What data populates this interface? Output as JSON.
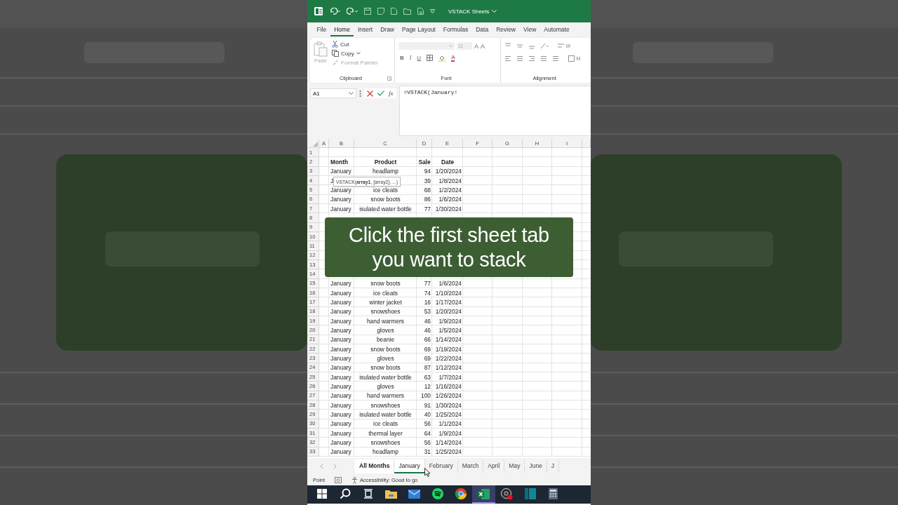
{
  "backdrop": {
    "kind": "picture"
  },
  "title_bar": {
    "title": "VSTACK Sheets"
  },
  "menu_tabs": [
    {
      "label": "File",
      "selected": false
    },
    {
      "label": "Home",
      "selected": true
    },
    {
      "label": "Insert",
      "selected": false
    },
    {
      "label": "Draw",
      "selected": false
    },
    {
      "label": "Page Layout",
      "selected": false
    },
    {
      "label": "Formulas",
      "selected": false
    },
    {
      "label": "Data",
      "selected": false
    },
    {
      "label": "Review",
      "selected": false
    },
    {
      "label": "View",
      "selected": false
    },
    {
      "label": "Automate",
      "selected": false
    }
  ],
  "ribbon": {
    "clipboard": {
      "paste": "Paste",
      "cut": "Cut",
      "copy": "Copy",
      "format_painter": "Format Painter",
      "label": "Clipboard"
    },
    "font": {
      "size": "11",
      "size_buttons": [
        "A",
        "A"
      ],
      "style_buttons": [
        "B",
        "I",
        "U"
      ],
      "font_color": "A",
      "label": "Font"
    },
    "alignment": {
      "label": "Alignment",
      "wrap_partial": "W",
      "merge_partial": "M"
    }
  },
  "formula_bar": {
    "name_box": "A1",
    "fx": "fx",
    "formula": "=VSTACK(January!"
  },
  "columns": [
    "A",
    "B",
    "C",
    "D",
    "E",
    "F",
    "G",
    "H",
    "I"
  ],
  "rows": [
    {
      "number": "1"
    },
    {
      "number": "2",
      "kind": "header",
      "month": "Month",
      "product": "Product",
      "sale": "Sale",
      "date": "Date"
    },
    {
      "number": "3",
      "month": "January",
      "product": "headlamp",
      "sale": "94",
      "date": "1/20/2024"
    },
    {
      "number": "4",
      "month": "J",
      "sale": "39",
      "date": "1/8/2024"
    },
    {
      "number": "5",
      "month": "January",
      "product": "ice cleats",
      "sale": "68",
      "date": "1/2/2024"
    },
    {
      "number": "6",
      "month": "January",
      "product": "snow boots",
      "sale": "86",
      "date": "1/6/2024"
    },
    {
      "number": "7",
      "month": "January",
      "product": "isulated water bottle",
      "sale": "77",
      "date": "1/30/2024"
    },
    {
      "number": "8"
    },
    {
      "number": "9"
    },
    {
      "number": "10"
    },
    {
      "number": "11"
    },
    {
      "number": "12"
    },
    {
      "number": "13"
    },
    {
      "number": "14"
    },
    {
      "number": "15",
      "month": "January",
      "product": "snow boots",
      "sale": "77",
      "date": "1/6/2024"
    },
    {
      "number": "16",
      "month": "January",
      "product": "ice cleats",
      "sale": "74",
      "date": "1/10/2024"
    },
    {
      "number": "17",
      "month": "January",
      "product": "winter jacket",
      "sale": "16",
      "date": "1/17/2024"
    },
    {
      "number": "18",
      "month": "January",
      "product": "snowshoes",
      "sale": "53",
      "date": "1/20/2024"
    },
    {
      "number": "19",
      "month": "January",
      "product": "hand warmers",
      "sale": "46",
      "date": "1/9/2024"
    },
    {
      "number": "20",
      "month": "January",
      "product": "gloves",
      "sale": "46",
      "date": "1/5/2024"
    },
    {
      "number": "21",
      "month": "January",
      "product": "beanie",
      "sale": "66",
      "date": "1/14/2024"
    },
    {
      "number": "22",
      "month": "January",
      "product": "snow boots",
      "sale": "69",
      "date": "1/19/2024"
    },
    {
      "number": "23",
      "month": "January",
      "product": "gloves",
      "sale": "69",
      "date": "1/22/2024"
    },
    {
      "number": "24",
      "month": "January",
      "product": "snow boots",
      "sale": "87",
      "date": "1/12/2024"
    },
    {
      "number": "25",
      "month": "January",
      "product": "isulated water bottle",
      "sale": "63",
      "date": "1/7/2024"
    },
    {
      "number": "26",
      "month": "January",
      "product": "gloves",
      "sale": "12",
      "date": "1/16/2024"
    },
    {
      "number": "27",
      "month": "January",
      "product": "hand warmers",
      "sale": "100",
      "date": "1/26/2024"
    },
    {
      "number": "28",
      "month": "January",
      "product": "snowshoes",
      "sale": "91",
      "date": "1/30/2024"
    },
    {
      "number": "29",
      "month": "January",
      "product": "isulated water bottle",
      "sale": "40",
      "date": "1/25/2024"
    },
    {
      "number": "30",
      "month": "January",
      "product": "ice cleats",
      "sale": "56",
      "date": "1/1/2024"
    },
    {
      "number": "31",
      "month": "January",
      "product": "thermal layer",
      "sale": "64",
      "date": "1/9/2024"
    },
    {
      "number": "32",
      "month": "January",
      "product": "snowshoes",
      "sale": "56",
      "date": "1/14/2024"
    },
    {
      "number": "33",
      "month": "January",
      "product": "headlamp",
      "sale": "31",
      "date": "1/25/2024"
    }
  ],
  "tooltip": "VSTACK(**array1**, [array2], ...)",
  "caption": "Click the first sheet tab you want to stack",
  "sheet_tabs": [
    {
      "label": "All Months",
      "selected": false,
      "bold": true
    },
    {
      "label": "January",
      "selected": true,
      "bold": false
    },
    {
      "label": "February",
      "selected": false,
      "bold": false
    },
    {
      "label": "March",
      "selected": false,
      "bold": false
    },
    {
      "label": "April",
      "selected": false,
      "bold": false
    },
    {
      "label": "May",
      "selected": false,
      "bold": false
    },
    {
      "label": "June",
      "selected": false,
      "bold": false
    },
    {
      "label": "J",
      "selected": false,
      "bold": false
    }
  ],
  "status_bar": {
    "mode": "Point",
    "accessibility": "Accessibility: Good to go"
  },
  "taskbar": [
    {
      "kind": "start",
      "selected": false
    },
    {
      "kind": "search",
      "selected": false
    },
    {
      "kind": "taskview",
      "selected": false
    },
    {
      "kind": "folder",
      "selected": false
    },
    {
      "kind": "mail",
      "selected": false
    },
    {
      "kind": "music",
      "selected": false
    },
    {
      "kind": "browser",
      "selected": false
    },
    {
      "kind": "spreadsheet",
      "selected": true
    },
    {
      "kind": "recorder",
      "selected": false
    },
    {
      "kind": "panel",
      "selected": false
    },
    {
      "kind": "calculator",
      "selected": false
    }
  ]
}
